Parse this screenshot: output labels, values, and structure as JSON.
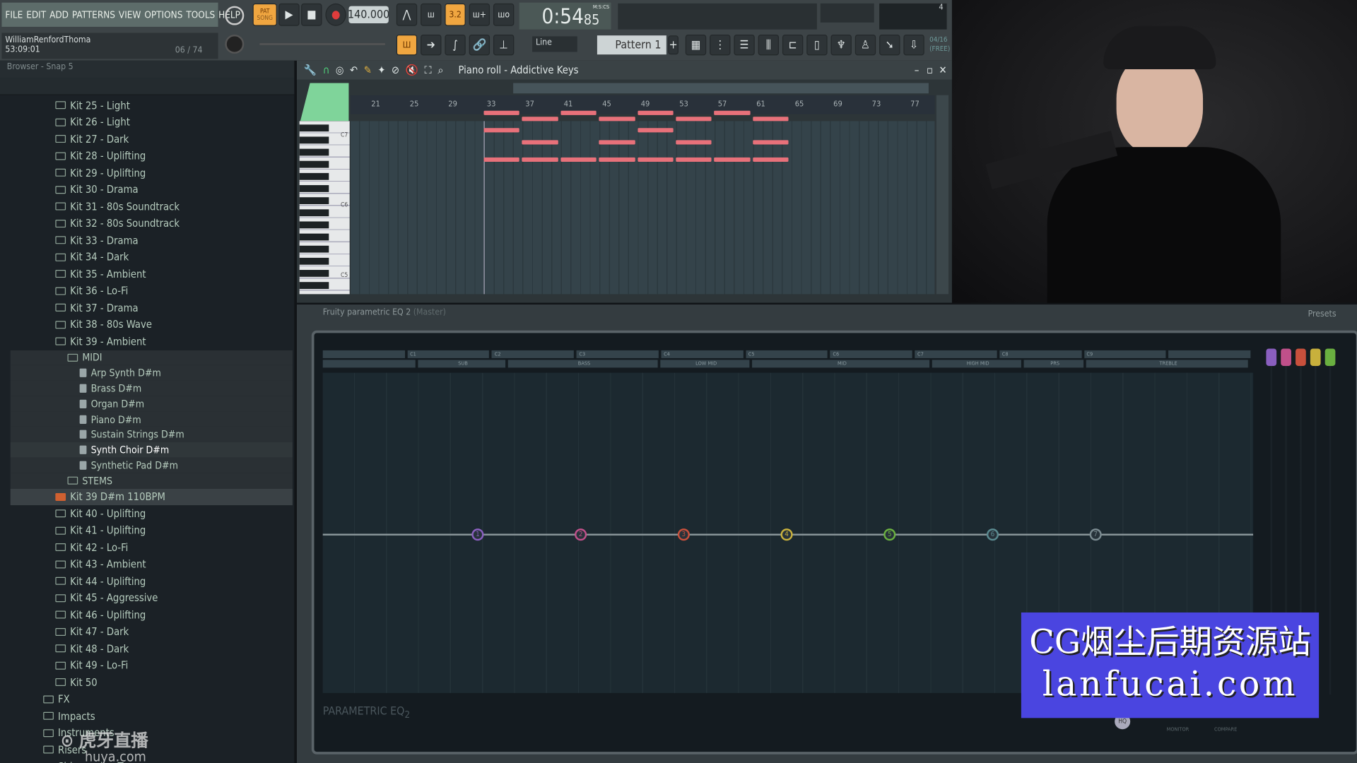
{
  "menu": [
    "FILE",
    "EDIT",
    "ADD",
    "PATTERNS",
    "VIEW",
    "OPTIONS",
    "TOOLS",
    "HELP"
  ],
  "hint": {
    "name": "WilliamRenfordThoma",
    "time": "53:09:01",
    "count": "06 / 74"
  },
  "transport": {
    "pat": "PAT",
    "song": "SONG",
    "tempo": "140.000",
    "time": "0:54",
    "time_cs": "85",
    "time_unit": "M:S:CS",
    "snap": "Line",
    "pattern": "Pattern 1",
    "counter": "04/16",
    "free": "(FREE)",
    "snap_beat": "3.2"
  },
  "browser": {
    "title": "Browser - Snap 5",
    "items": [
      {
        "label": "Kit 25 - Light",
        "type": "folder"
      },
      {
        "label": "Kit 26 - Light",
        "type": "folder"
      },
      {
        "label": "Kit 27 - Dark",
        "type": "folder"
      },
      {
        "label": "Kit 28 - Uplifting",
        "type": "folder"
      },
      {
        "label": "Kit 29 - Uplifting",
        "type": "folder"
      },
      {
        "label": "Kit 30 - Drama",
        "type": "folder"
      },
      {
        "label": "Kit 31 - 80s Soundtrack",
        "type": "folder"
      },
      {
        "label": "Kit 32 - 80s Soundtrack",
        "type": "folder"
      },
      {
        "label": "Kit 33 - Drama",
        "type": "folder"
      },
      {
        "label": "Kit 34 - Dark",
        "type": "folder"
      },
      {
        "label": "Kit 35 - Ambient",
        "type": "folder"
      },
      {
        "label": "Kit 36 - Lo-Fi",
        "type": "folder"
      },
      {
        "label": "Kit 37 - Drama",
        "type": "folder"
      },
      {
        "label": "Kit 38 - 80s Wave",
        "type": "folder"
      },
      {
        "label": "Kit 39 - Ambient",
        "type": "folder",
        "state": "open"
      },
      {
        "label": "MIDI",
        "type": "folder",
        "depth": 1
      },
      {
        "label": "Arp Synth D#m",
        "type": "file",
        "depth": 2
      },
      {
        "label": "Brass D#m",
        "type": "file",
        "depth": 2
      },
      {
        "label": "Organ D#m",
        "type": "file",
        "depth": 2
      },
      {
        "label": "Piano D#m",
        "type": "file",
        "depth": 2
      },
      {
        "label": "Sustain Strings D#m",
        "type": "file",
        "depth": 2
      },
      {
        "label": "Synth Choir D#m",
        "type": "file",
        "depth": 2,
        "state": "selected"
      },
      {
        "label": "Synthetic Pad D#m",
        "type": "file",
        "depth": 2
      },
      {
        "label": "STEMS",
        "type": "folder",
        "depth": 1
      },
      {
        "label": "Kit 39 D#m 110BPM",
        "type": "project",
        "state": "highlighted"
      },
      {
        "label": "Kit 40 - Uplifting",
        "type": "folder"
      },
      {
        "label": "Kit 41 - Uplifting",
        "type": "folder"
      },
      {
        "label": "Kit 42 - Lo-Fi",
        "type": "folder"
      },
      {
        "label": "Kit 43 - Ambient",
        "type": "folder"
      },
      {
        "label": "Kit 44 - Uplifting",
        "type": "folder"
      },
      {
        "label": "Kit 45 - Aggressive",
        "type": "folder"
      },
      {
        "label": "Kit 46 - Uplifting",
        "type": "folder"
      },
      {
        "label": "Kit 47 - Dark",
        "type": "folder"
      },
      {
        "label": "Kit 48 - Dark",
        "type": "folder"
      },
      {
        "label": "Kit 49 -  Lo-Fi",
        "type": "folder"
      },
      {
        "label": "Kit 50",
        "type": "folder"
      },
      {
        "label": "FX",
        "type": "folder",
        "depth": -1
      },
      {
        "label": "Impacts",
        "type": "folder",
        "depth": -1
      },
      {
        "label": "Instruments",
        "type": "folder",
        "depth": -1
      },
      {
        "label": "Risers",
        "type": "folder",
        "depth": -1
      },
      {
        "label": "Shimmering Tones",
        "type": "folder",
        "depth": -1
      }
    ]
  },
  "piano_roll": {
    "title": "Piano roll - Addictive Keys",
    "ruler": [
      "21",
      "25",
      "29",
      "33",
      "37",
      "41",
      "45",
      "49",
      "53",
      "57",
      "61",
      "65",
      "69",
      "73",
      "77"
    ],
    "key_labels": [
      "C7",
      "C6",
      "C5"
    ],
    "note_color": "#e8717a",
    "notes": [
      {
        "row": 0,
        "start": 33,
        "len": 4
      },
      {
        "row": 0,
        "start": 41,
        "len": 4
      },
      {
        "row": 0,
        "start": 49,
        "len": 4
      },
      {
        "row": 0,
        "start": 57,
        "len": 4
      },
      {
        "row": 1,
        "start": 37,
        "len": 4
      },
      {
        "row": 1,
        "start": 45,
        "len": 4
      },
      {
        "row": 1,
        "start": 53,
        "len": 4
      },
      {
        "row": 1,
        "start": 61,
        "len": 4
      },
      {
        "row": 2,
        "start": 33,
        "len": 4
      },
      {
        "row": 2,
        "start": 49,
        "len": 4
      },
      {
        "row": 3,
        "start": 37,
        "len": 4
      },
      {
        "row": 3,
        "start": 45,
        "len": 4
      },
      {
        "row": 3,
        "start": 53,
        "len": 4
      },
      {
        "row": 3,
        "start": 61,
        "len": 4
      },
      {
        "row": 4,
        "start": 33,
        "len": 4
      },
      {
        "row": 4,
        "start": 37,
        "len": 4
      },
      {
        "row": 4,
        "start": 41,
        "len": 4
      },
      {
        "row": 4,
        "start": 45,
        "len": 4
      },
      {
        "row": 4,
        "start": 49,
        "len": 4
      },
      {
        "row": 4,
        "start": 53,
        "len": 4
      },
      {
        "row": 4,
        "start": 57,
        "len": 4
      },
      {
        "row": 4,
        "start": 61,
        "len": 4
      }
    ]
  },
  "eq": {
    "title": "Fruity parametric EQ 2",
    "target": "(Master)",
    "presets": "Presets",
    "logo": "PARAMETRIC EQ",
    "logo_sub": "2",
    "octaves": [
      "",
      "C1",
      "C2",
      "C3",
      "C4",
      "C5",
      "C6",
      "C7",
      "C8",
      "C9",
      ""
    ],
    "ranges": [
      "",
      "SUB",
      "BASS",
      "LOW MID",
      "MID",
      "HIGH MID",
      "PRS",
      "TREBLE"
    ],
    "bands": [
      {
        "n": "1",
        "color": "#8a5fbf"
      },
      {
        "n": "2",
        "color": "#c0508a"
      },
      {
        "n": "3",
        "color": "#c8503c"
      },
      {
        "n": "4",
        "color": "#c8b03c"
      },
      {
        "n": "5",
        "color": "#6ab040"
      },
      {
        "n": "6",
        "color": "#5a8a90"
      },
      {
        "n": "7",
        "color": "#7a8a90"
      }
    ],
    "monitor": "MONITOR",
    "compare": "COMPARE",
    "hq": "HQ"
  },
  "watermark": {
    "line1": "CG烟尘后期资源站",
    "line2": "lanfucai.com"
  },
  "huya": {
    "cn": "虎牙直播",
    "en": "huya.com"
  }
}
